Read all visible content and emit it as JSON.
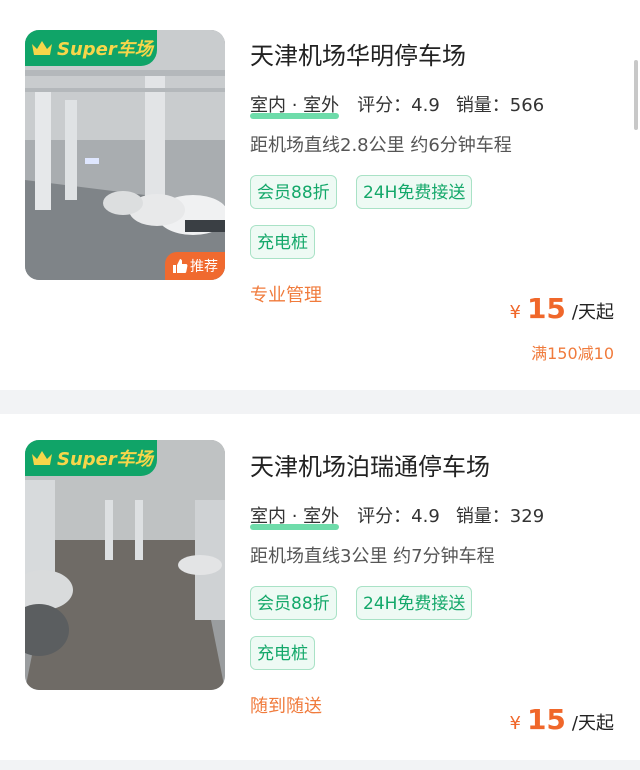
{
  "listings": [
    {
      "badge": "Super车场",
      "recommend": "推荐",
      "title": "天津机场华明停车场",
      "env": "室内 · 室外",
      "rating": "评分：4.9",
      "sales": "销量：566",
      "distance": "距机场直线2.8公里 约6分钟车程",
      "tags": [
        "会员88折",
        "24H免费接送",
        "充电桩"
      ],
      "promo": "专业管理",
      "price_symbol": "¥",
      "price": "15",
      "price_unit": "/天起",
      "discount": "满150减10"
    },
    {
      "badge": "Super车场",
      "title": "天津机场泊瑞通停车场",
      "env": "室内 · 室外",
      "rating": "评分：4.9",
      "sales": "销量：329",
      "distance": "距机场直线3公里 约7分钟车程",
      "tags": [
        "会员88折",
        "24H免费接送",
        "充电桩"
      ],
      "promo": "随到随送",
      "price_symbol": "¥",
      "price": "15",
      "price_unit": "/天起"
    }
  ],
  "colors": {
    "brand_green": "#10a468",
    "tag_green": "#14a86a",
    "price_orange": "#f0672a",
    "badge_yellow": "#f7d64a"
  }
}
